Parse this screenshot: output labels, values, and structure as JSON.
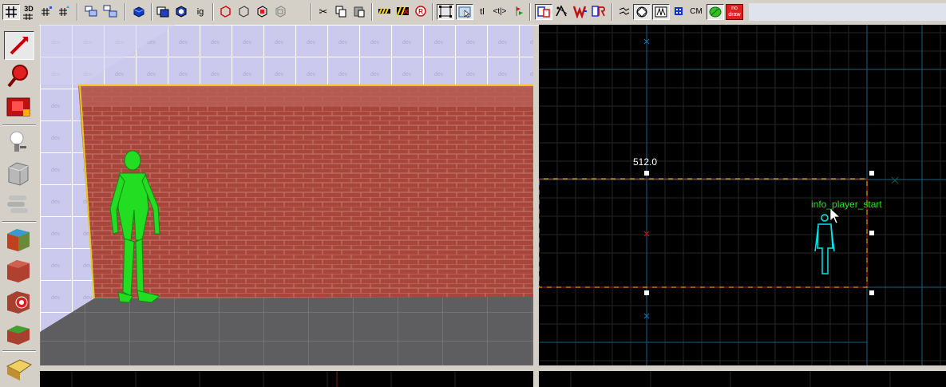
{
  "toolbar": {
    "buttons": [
      {
        "name": "grid-toggle-icon",
        "label": ""
      },
      {
        "name": "3d-grid-icon",
        "label": "3D"
      },
      {
        "name": "smaller-grid-icon",
        "label": ""
      },
      {
        "name": "larger-grid-icon",
        "label": ""
      },
      {
        "name": "group-icon",
        "label": ""
      },
      {
        "name": "ungroup-icon",
        "label": ""
      },
      {
        "name": "hide-icon",
        "label": ""
      },
      {
        "name": "carve-icon",
        "label": ""
      },
      {
        "name": "hollow-icon",
        "label": ""
      },
      {
        "name": "ignore-groups-label",
        "label": "ig"
      },
      {
        "name": "tie-to-entity-icon",
        "label": ""
      },
      {
        "name": "move-to-world-icon",
        "label": ""
      },
      {
        "name": "entity-icon",
        "label": ""
      },
      {
        "name": "brushes-icon",
        "label": ""
      },
      {
        "name": "cut-icon",
        "label": ""
      },
      {
        "name": "copy-icon",
        "label": ""
      },
      {
        "name": "paste-icon",
        "label": ""
      },
      {
        "name": "texture-lock-icon",
        "label": ""
      },
      {
        "name": "texture-scale-lock-icon",
        "label": ""
      },
      {
        "name": "radius-icon",
        "label": "R"
      },
      {
        "name": "select-box-icon",
        "label": ""
      },
      {
        "name": "select-object-icon",
        "label": ""
      },
      {
        "name": "texture-label",
        "label": "tl"
      },
      {
        "name": "arrows-label",
        "label": "<t>"
      },
      {
        "name": "flag-icon",
        "label": ""
      },
      {
        "name": "check-problems-icon",
        "label": ""
      },
      {
        "name": "map-properties-icon",
        "label": ""
      },
      {
        "name": "entity-report-icon",
        "label": ""
      },
      {
        "name": "find-icon",
        "label": ""
      },
      {
        "name": "vertex-icon",
        "label": ""
      },
      {
        "name": "clipping-icon",
        "label": ""
      },
      {
        "name": "wireframe-icon",
        "label": ""
      },
      {
        "name": "run-map-icon",
        "label": ""
      },
      {
        "name": "cordon-label",
        "label": "CM"
      },
      {
        "name": "green-leaf-icon",
        "label": ""
      },
      {
        "name": "nodraw-icon",
        "label": "no\ndraw"
      }
    ],
    "nodraw_top": "no",
    "nodraw_bottom": "draw",
    "three_d": "3D",
    "ig": "ig",
    "tl": "tl",
    "arrows": "<t|>",
    "cm": "CM",
    "radius": "R"
  },
  "left_tools": [
    "selection-tool",
    "magnify-tool",
    "camera-tool",
    "entity-tool",
    "block-tool",
    "texture-tool",
    "apply-texture-tool",
    "decal-tool",
    "overlay-tool",
    "clipping-tool",
    "vertex-tool"
  ],
  "view2d": {
    "size_label": "512.0",
    "entity_label": "info_player_start"
  },
  "colors": {
    "toolbar_bg": "#d4d0c8",
    "grid_major": "#1e5a7a",
    "grid_minor": "#202020",
    "selection": "#ffd000",
    "entity": "#00e8e8"
  }
}
